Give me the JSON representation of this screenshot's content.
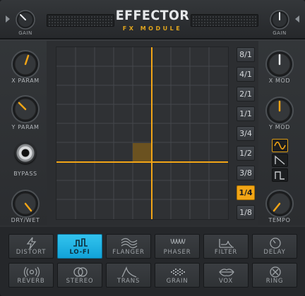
{
  "header": {
    "title": "EFFECTOR",
    "subtitle": "FX MODULE",
    "gain_left_label": "GAIN",
    "gain_right_label": "GAIN"
  },
  "left_panel": {
    "x_param_label": "X PARAM",
    "y_param_label": "Y PARAM",
    "bypass_label": "BYPASS",
    "dry_wet_label": "DRY/WET"
  },
  "right_panel": {
    "x_mod_label": "X MOD",
    "y_mod_label": "Y MOD",
    "tempo_label": "TEMPO",
    "shapes": [
      "sine-wave-icon",
      "ramp-wave-icon",
      "square-wave-icon"
    ],
    "active_shape": "sine-wave-icon"
  },
  "rates": [
    "8/1",
    "4/1",
    "2/1",
    "1/1",
    "3/4",
    "1/2",
    "3/8",
    "1/4",
    "1/8"
  ],
  "active_rate": "1/4",
  "effects": [
    {
      "label": "DISTORT",
      "icon": "lightning-icon"
    },
    {
      "label": "LO-FI",
      "icon": "square-step-icon"
    },
    {
      "label": "FLANGER",
      "icon": "wave-lines-icon"
    },
    {
      "label": "PHASER",
      "icon": "phaser-waves-icon"
    },
    {
      "label": "FILTER",
      "icon": "filter-curve-icon"
    },
    {
      "label": "DELAY",
      "icon": "clock-icon"
    },
    {
      "label": "REVERB",
      "icon": "radiate-icon"
    },
    {
      "label": "STEREO",
      "icon": "rings-icon"
    },
    {
      "label": "TRANS",
      "icon": "transient-icon"
    },
    {
      "label": "GRAIN",
      "icon": "grain-dots-icon"
    },
    {
      "label": "VOX",
      "icon": "lips-icon"
    },
    {
      "label": "RING",
      "icon": "ring-mod-icon"
    }
  ],
  "active_effect": "LO-FI",
  "colors": {
    "accent": "#f2a516",
    "active_fx": "#1fb4e5",
    "panel": "#2c2e31"
  }
}
